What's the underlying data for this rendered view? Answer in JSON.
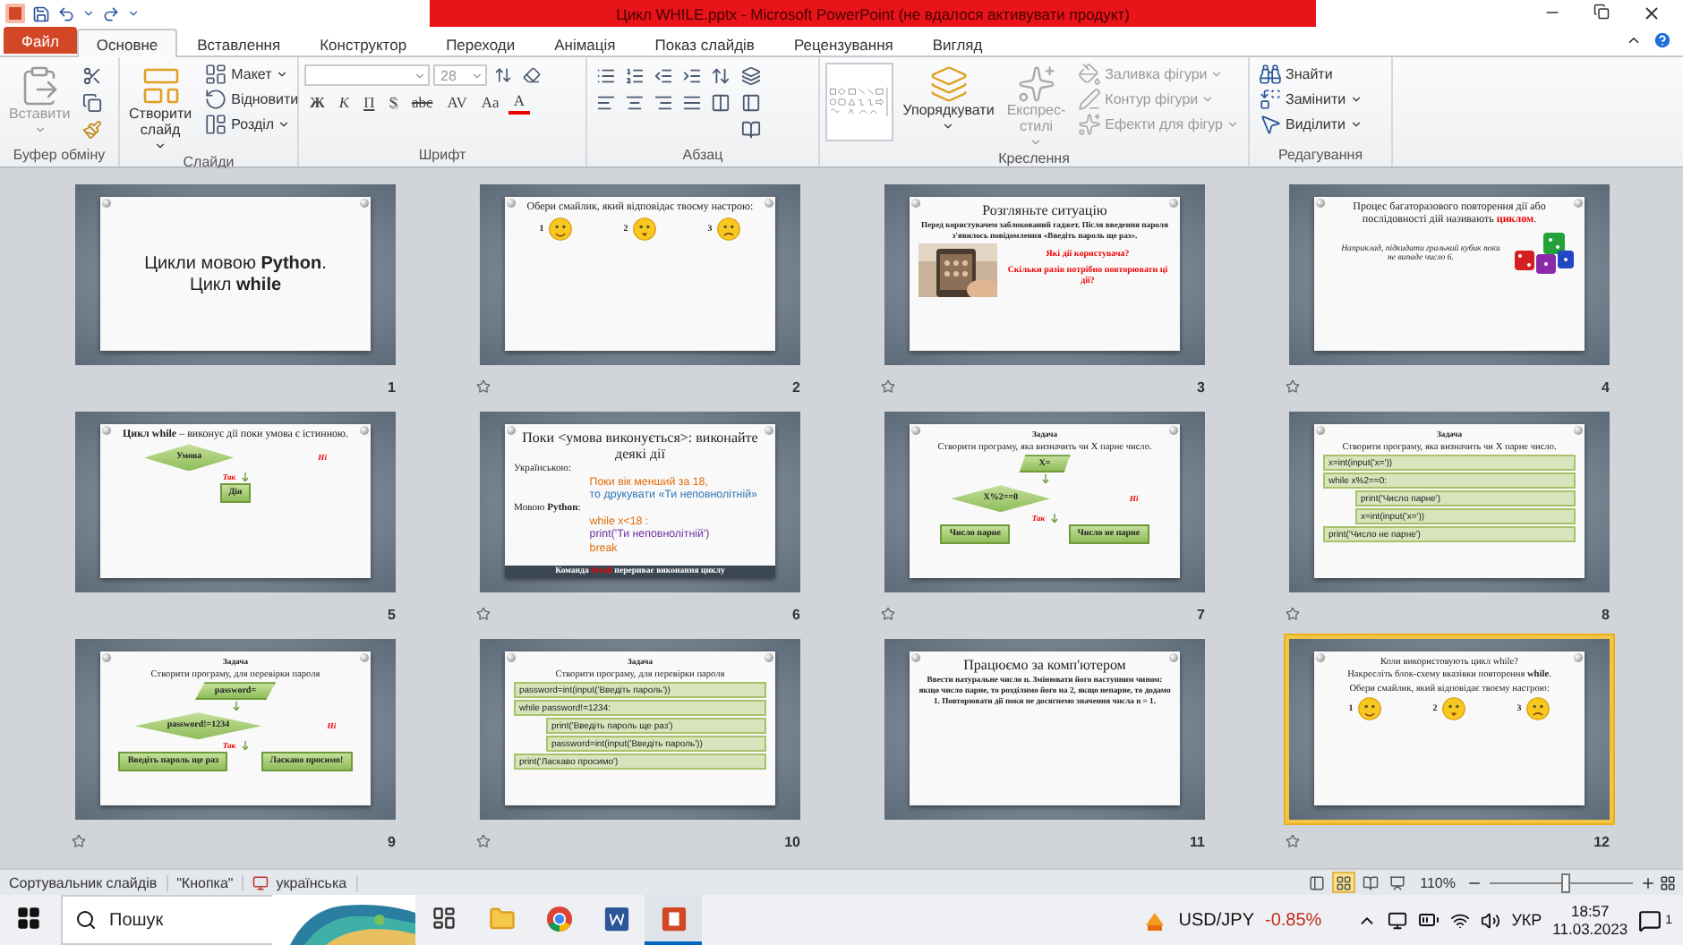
{
  "window": {
    "title": "Цикл WHILE.pptx  -  Microsoft PowerPoint (не вдалося активувати продукт)"
  },
  "tabs": [
    {
      "label": "Файл",
      "kind": "file",
      "selected": false
    },
    {
      "label": "Основне",
      "kind": "tab",
      "selected": true
    },
    {
      "label": "Вставлення",
      "kind": "tab",
      "selected": false
    },
    {
      "label": "Конструктор",
      "kind": "tab",
      "selected": false
    },
    {
      "label": "Переходи",
      "kind": "tab",
      "selected": false
    },
    {
      "label": "Анімація",
      "kind": "tab",
      "selected": false
    },
    {
      "label": "Показ слайдів",
      "kind": "tab",
      "selected": false
    },
    {
      "label": "Рецензування",
      "kind": "tab",
      "selected": false
    },
    {
      "label": "Вигляд",
      "kind": "tab",
      "selected": false
    }
  ],
  "ribbon": {
    "groups": [
      {
        "kind": "clipboard",
        "label": "Буфер обміну",
        "large": [
          {
            "label": "Вставити",
            "disabled": true,
            "dropdown": true
          }
        ]
      },
      {
        "kind": "slides",
        "label": "Слайди",
        "large": [
          {
            "label": "Створити слайд",
            "disabled": false,
            "dropdown": true
          }
        ],
        "small": [
          {
            "label": "Макет",
            "disabled": false,
            "dropdown": true
          },
          {
            "label": "Відновити",
            "disabled": false,
            "dropdown": false
          },
          {
            "label": "Розділ",
            "disabled": false,
            "dropdown": true
          }
        ]
      },
      {
        "kind": "font",
        "label": "Шрифт",
        "font_size": "28",
        "buttons": [
          {
            "label": "Ж",
            "kind": "bold"
          },
          {
            "label": "К",
            "kind": "italic"
          },
          {
            "label": "П",
            "kind": "underline"
          },
          {
            "label": "S",
            "kind": "shadow"
          },
          {
            "label": "abc",
            "kind": "strike"
          },
          {
            "label": "AV",
            "kind": "spacing"
          },
          {
            "label": "Aa",
            "kind": "case"
          },
          {
            "label": "A",
            "kind": "color"
          }
        ]
      },
      {
        "kind": "paragraph",
        "label": "Абзац"
      },
      {
        "kind": "drawing",
        "label": "Креслення",
        "large": [
          {
            "label": "Упорядкувати",
            "disabled": false,
            "dropdown": true
          },
          {
            "label": "Експрес-стилі",
            "disabled": true,
            "dropdown": true
          }
        ],
        "small": [
          {
            "label": "Заливка фігури",
            "disabled": true,
            "dropdown": true
          },
          {
            "label": "Контур фігури",
            "disabled": true,
            "dropdown": true
          },
          {
            "label": "Ефекти для фігур",
            "disabled": true,
            "dropdown": true
          }
        ]
      },
      {
        "kind": "editing",
        "label": "Редагування",
        "small": [
          {
            "label": "Знайти",
            "disabled": false,
            "dropdown": false
          },
          {
            "label": "Замінити",
            "disabled": false,
            "dropdown": true
          },
          {
            "label": "Виділити",
            "disabled": false,
            "dropdown": true
          }
        ]
      }
    ]
  },
  "slides": [
    {
      "number": "1",
      "selected": false,
      "transition": false,
      "items": [
        {
          "kind": "title",
          "text": "Цикли мовою **Python**. Цикл **while**"
        }
      ]
    },
    {
      "number": "2",
      "selected": false,
      "transition": true,
      "items": [
        {
          "kind": "lead",
          "text": "Обери смайлик, який відповідає твоєму настрою:"
        },
        {
          "kind": "smileys",
          "labels": [
            "1",
            "2",
            "3"
          ]
        }
      ]
    },
    {
      "number": "3",
      "selected": false,
      "transition": true,
      "items": [
        {
          "kind": "title",
          "text": "Розгляньте ситуацію"
        },
        {
          "kind": "heading",
          "text": "Перед користувачем заблокований гаджет. Після введення пароля з'явилось повідомлення «Введіть пароль ще раз»."
        },
        {
          "kind": "picture_row",
          "alerts": [
            "Які дії користувача?",
            "Скільки разів потрібно повторювати ці дії?"
          ]
        }
      ]
    },
    {
      "number": "4",
      "selected": false,
      "transition": true,
      "items": [
        {
          "kind": "lead",
          "parts": [
            {
              "text": "Процес багаторазового повторення дії або послідовності дій називають ",
              "kind": "plain"
            },
            {
              "text": "циклом",
              "kind": "keyword"
            },
            {
              "text": ".",
              "kind": "plain"
            }
          ]
        },
        {
          "kind": "dice_row",
          "text": "Наприклад, підкидати гральний кубик поки не випаде число 6."
        }
      ]
    },
    {
      "number": "5",
      "selected": false,
      "transition": false,
      "items": [
        {
          "kind": "lead",
          "text": "**Цикл while** – виконує дії поки умова є істинною."
        },
        {
          "kind": "flow",
          "yes": "Так",
          "no": "Ні",
          "rows": [
            [
              {
                "kind": "decision",
                "text": "Умова"
              }
            ],
            [
              {
                "kind": "process",
                "text": "Дія"
              }
            ]
          ]
        }
      ]
    },
    {
      "number": "6",
      "selected": false,
      "transition": true,
      "items": [
        {
          "kind": "title",
          "text": "Поки <умова виконується>: виконайте деякі дії"
        },
        {
          "kind": "label",
          "text": "Українською:"
        },
        {
          "kind": "colored",
          "text": "Поки вік менший за 18,",
          "color": "#e36c09"
        },
        {
          "kind": "colored",
          "text": "то друкувати «Ти неповнолітній»",
          "color": "#2e75b6"
        },
        {
          "kind": "label",
          "text": "Мовою **Python**:"
        },
        {
          "kind": "colored",
          "text": "while x<18 :",
          "color": "#e36c09"
        },
        {
          "kind": "colored",
          "text": "print('Ти неповнолітній')",
          "color": "#7030a0"
        },
        {
          "kind": "colored",
          "text": "break",
          "color": "#e36c09"
        },
        {
          "kind": "footer",
          "parts": [
            {
              "text": "Команда ",
              "kind": "plain"
            },
            {
              "text": "break",
              "kind": "keyword"
            },
            {
              "text": " перериває виконання циклу",
              "kind": "plain"
            }
          ]
        }
      ]
    },
    {
      "number": "7",
      "selected": false,
      "transition": true,
      "items": [
        {
          "kind": "heading",
          "text": "Задача"
        },
        {
          "kind": "text",
          "text": "Створити програму, яка визначить чи Х парне число."
        },
        {
          "kind": "flow",
          "yes": "Так",
          "no": "Ні",
          "rows": [
            [
              {
                "kind": "io",
                "text": "X="
              }
            ],
            [
              {
                "kind": "decision",
                "text": "X%2==0"
              }
            ],
            [
              {
                "kind": "process",
                "text": "Число парне"
              },
              {
                "kind": "process",
                "text": "Число не парне"
              }
            ]
          ]
        }
      ]
    },
    {
      "number": "8",
      "selected": false,
      "transition": true,
      "items": [
        {
          "kind": "heading",
          "text": "Задача"
        },
        {
          "kind": "text",
          "text": "Створити програму, яка визначить чи Х парне число."
        },
        {
          "kind": "code",
          "text": "x=int(input('x='))"
        },
        {
          "kind": "code",
          "text": "while x%2==0:",
          "children": [
            {
              "kind": "code",
              "text": "print('Число парне')"
            },
            {
              "kind": "code",
              "text": "x=int(input('x='))"
            }
          ]
        },
        {
          "kind": "code",
          "text": "print('Число не парне')"
        }
      ]
    },
    {
      "number": "9",
      "selected": false,
      "transition": true,
      "items": [
        {
          "kind": "heading",
          "text": "Задача"
        },
        {
          "kind": "text",
          "text": "Створити програму, для перевірки пароля"
        },
        {
          "kind": "flow",
          "yes": "Так",
          "no": "Ні",
          "rows": [
            [
              {
                "kind": "io",
                "text": "password="
              }
            ],
            [
              {
                "kind": "decision",
                "text": "password!=1234"
              }
            ],
            [
              {
                "kind": "process",
                "text": "Введіть пароль ще раз"
              },
              {
                "kind": "process",
                "text": "Ласкаво просимо!"
              }
            ]
          ]
        }
      ]
    },
    {
      "number": "10",
      "selected": false,
      "transition": true,
      "items": [
        {
          "kind": "heading",
          "text": "Задача"
        },
        {
          "kind": "text",
          "text": "Створити програму, для перевірки пароля"
        },
        {
          "kind": "code",
          "text": "password=int(input('Введіть пароль'))"
        },
        {
          "kind": "code",
          "text": "while password!=1234:",
          "children": [
            {
              "kind": "code",
              "text": "print('Введіть пароль ще раз')"
            },
            {
              "kind": "code",
              "text": "password=int(input('Введіть пароль'))"
            }
          ]
        },
        {
          "kind": "code",
          "text": "print('Ласкаво просимо')"
        }
      ]
    },
    {
      "number": "11",
      "selected": false,
      "transition": false,
      "items": [
        {
          "kind": "title",
          "text": "Працюємо за комп'ютером"
        },
        {
          "kind": "heading",
          "text": "Ввести натуральне число n. Змінювати його наступним чином: якщо число парне, то розділимо його на 2, якщо непарне, то додамо 1. Повторювати дії поки не досягнемо значення числа n = 1."
        }
      ]
    },
    {
      "number": "12",
      "selected": true,
      "transition": true,
      "items": [
        {
          "kind": "text",
          "text": "Коли використовують цикл while?"
        },
        {
          "kind": "text",
          "text": "Накресліть блок-схему вказівки повторення **while**."
        },
        {
          "kind": "text",
          "text": "Обери смайлик, який відповідає твоєму настрою:"
        },
        {
          "kind": "smileys",
          "labels": [
            "1",
            "2",
            "3"
          ]
        }
      ]
    }
  ],
  "status_bar": {
    "view": "Сортувальник слайдів",
    "theme": "\"Кнопка\"",
    "language": "українська",
    "views": [
      {
        "selected": false
      },
      {
        "selected": true
      },
      {
        "selected": false
      },
      {
        "selected": false
      }
    ],
    "zoom": "110%",
    "zoom_slider": {
      "level": 0.52
    }
  },
  "taskbar": {
    "search_placeholder": "Пошук",
    "apps": [
      {
        "selected": false
      },
      {
        "selected": false
      },
      {
        "selected": false
      },
      {
        "selected": false
      },
      {
        "selected": true
      }
    ],
    "ticker": {
      "label": "USD/JPY",
      "change": "-0.85%"
    },
    "language": "УКР",
    "time": "18:57",
    "date": "11.03.2023",
    "notifications": "1"
  }
}
